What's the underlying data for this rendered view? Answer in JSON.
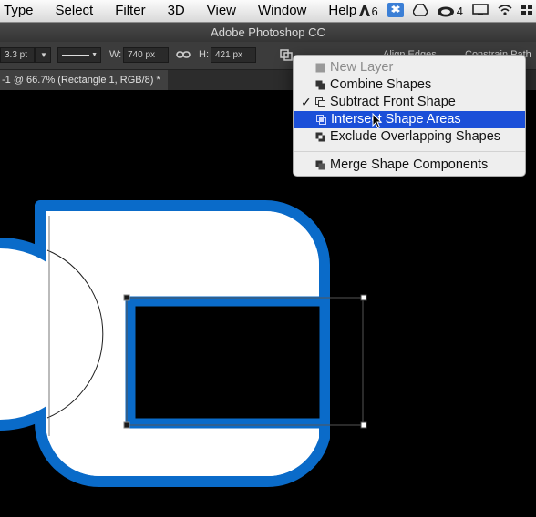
{
  "menubar": {
    "items": [
      "Type",
      "Select",
      "Filter",
      "3D",
      "View",
      "Window",
      "Help"
    ],
    "status": {
      "adobe_badge": "6",
      "cc_badge": "4"
    }
  },
  "titlebar": {
    "title": "Adobe Photoshop CC"
  },
  "options": {
    "stroke_size": "3.3 pt",
    "w_label": "W:",
    "w_value": "740 px",
    "h_label": "H:",
    "h_value": "421 px",
    "align_edges": "Align Edges",
    "constrain_path": "Constrain Path"
  },
  "document_tab": {
    "title": "-1 @ 66.7% (Rectangle 1, RGB/8) *"
  },
  "colors": {
    "shape_stroke": "#0a6bc9",
    "shape_fill": "#ffffff",
    "menu_highlight": "#1b4fd8"
  },
  "menu": {
    "new_layer": "New Layer",
    "combine": "Combine Shapes",
    "subtract": "Subtract Front Shape",
    "intersect": "Intersect Shape Areas",
    "exclude": "Exclude Overlapping Shapes",
    "merge": "Merge Shape Components",
    "checked_item": "Subtract Front Shape",
    "highlighted_item": "Intersect Shape Areas"
  }
}
